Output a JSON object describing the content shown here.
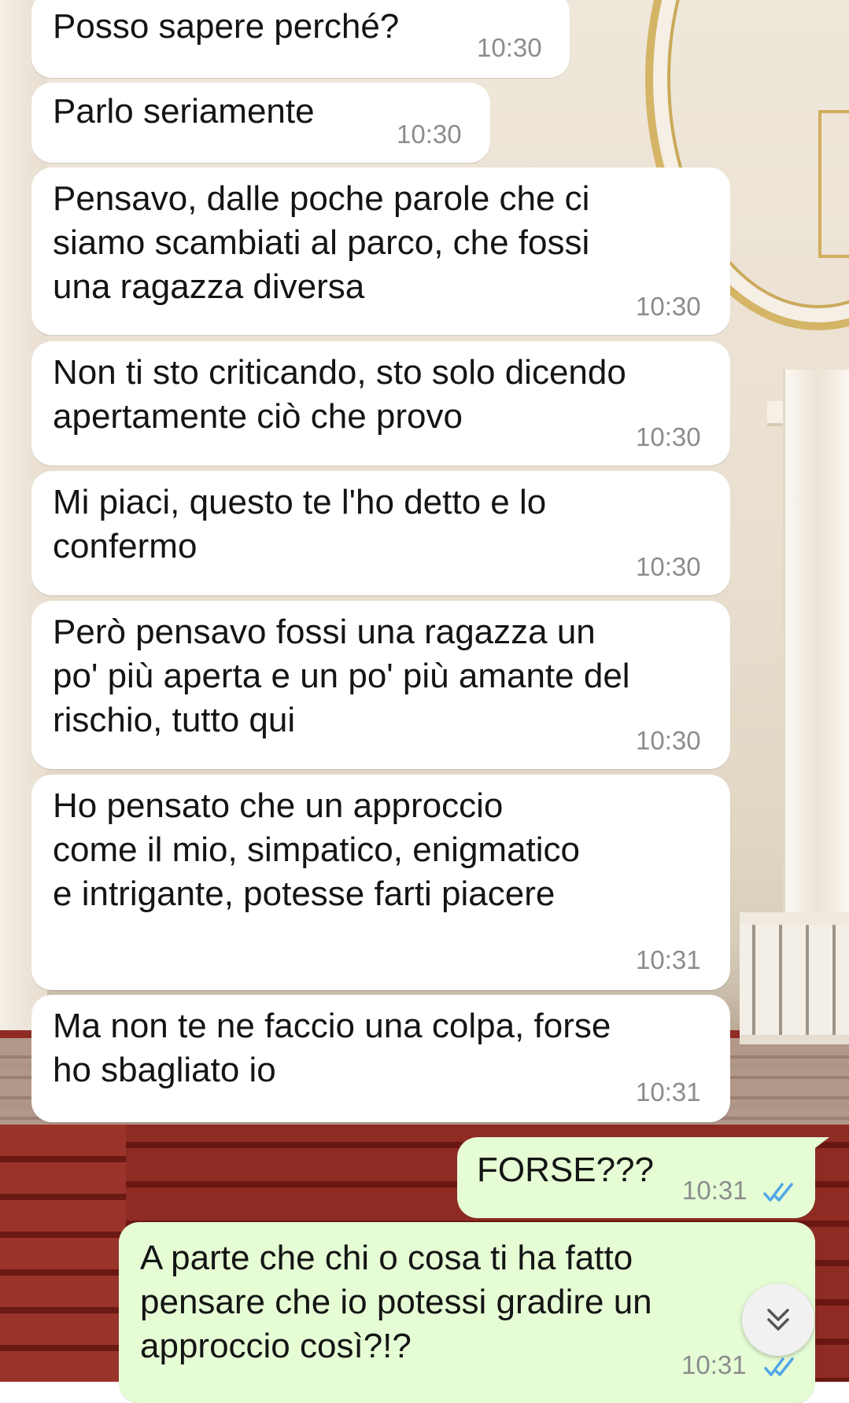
{
  "theme": {
    "incoming_bubble": "#ffffff",
    "outgoing_bubble": "#e5fcd5",
    "read_tick_color": "#4fa6e8",
    "timestamp_color": "#8c8c8c"
  },
  "messages": [
    {
      "direction": "in",
      "text": "Posso sapere perché?",
      "time": "10:30"
    },
    {
      "direction": "in",
      "text": "Parlo seriamente",
      "time": "10:30"
    },
    {
      "direction": "in",
      "text": "Pensavo, dalle poche parole che ci\nsiamo scambiati al parco, che fossi\nuna ragazza diversa",
      "time": "10:30"
    },
    {
      "direction": "in",
      "text": "Non ti sto criticando, sto solo dicendo\napertamente ciò che provo",
      "time": "10:30"
    },
    {
      "direction": "in",
      "text": "Mi piaci, questo te l'ho detto e lo\nconfermo",
      "time": "10:30"
    },
    {
      "direction": "in",
      "text": "Però pensavo fossi una ragazza un\npo' più aperta e un po' più amante del\nrischio, tutto qui",
      "time": "10:30"
    },
    {
      "direction": "in",
      "text": "Ho pensato che un approccio\ncome il mio, simpatico, enigmatico\ne intrigante, potesse farti piacere",
      "time": "10:31"
    },
    {
      "direction": "in",
      "text": "Ma non te ne faccio una colpa, forse\nho sbagliato io",
      "time": "10:31"
    },
    {
      "direction": "out",
      "text": "FORSE???",
      "time": "10:31",
      "status": "read",
      "status_icon": "double-check-icon"
    },
    {
      "direction": "out",
      "text": "A parte che chi o cosa ti ha fatto\npensare che io potessi gradire un\napproccio così?!?",
      "time": "10:31",
      "status": "read",
      "status_icon": "double-check-icon"
    }
  ],
  "scroll_button": {
    "icon": "double-chevron-down-icon"
  }
}
